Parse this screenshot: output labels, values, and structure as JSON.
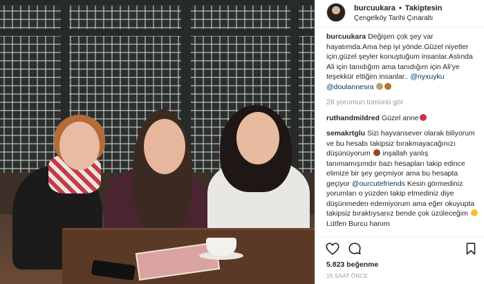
{
  "post": {
    "username": "burcuukara",
    "separator": "•",
    "follow_status": "Takiptesin",
    "location": "Çengelköy Tarihi Çınaraltı"
  },
  "caption": {
    "username": "burcuukara",
    "text": "Değişen çok şey var hayatımda.Ama hep iyi yönde.Güzel niyetler için,güzel şeyler konuştuğum insanlar.Aslında Ali için tanıdığım ama tanıdığım için Ali'ye teşekkür ettiğim insanlar..",
    "mention_1": "@nyxuyku",
    "mention_2": "@doulannesra"
  },
  "view_all_comments": "28 yorumun tümünü gör",
  "comments": [
    {
      "username": "ruthandmildred",
      "text": "Güzel anne"
    },
    {
      "username": "semakrtglu",
      "text_1": "Sizi hayvansever olarak biliyorum ve bu hesabı takipsiz bırakmayacağınızı düşünüyorum",
      "text_2": "inşallah yanlış tanımamışımdır bazı hesapları takip edince elimize bir şey geçmiyor ama bu hesapta geçiyor",
      "mention": "@ourcutefriends",
      "text_3": "Kesin görmediniz yorumları o yüzden takip etmediniz diye düşünmeden edemiyorum ama eğer okuyupta takipsiz bıraktıysanız bende çok üzüleceğim",
      "text_4": "Lütfen Burcu hanım"
    }
  ],
  "likes": "5.823 beğenme",
  "time_ago": "15 SAAT ÖNCE",
  "icons": {
    "like": "heart-icon",
    "comment": "comment-bubble-icon",
    "save": "bookmark-icon"
  },
  "colors": {
    "mention": "#003569",
    "muted": "#999999",
    "text": "#262626"
  }
}
